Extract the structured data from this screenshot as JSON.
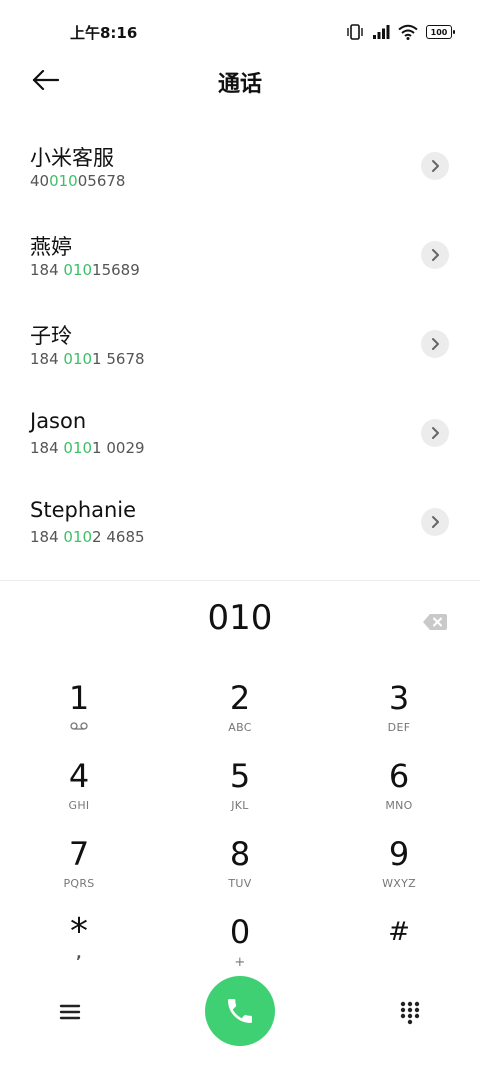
{
  "status_bar": {
    "time": "上午8:16",
    "battery": "100"
  },
  "header": {
    "title": "通话"
  },
  "contacts": [
    {
      "name": "小米客服",
      "number_pre": "40",
      "number_match": "010",
      "number_post": "05678"
    },
    {
      "name": "燕婷",
      "number_pre": "184 ",
      "number_match": "010",
      "number_post": "15689"
    },
    {
      "name": "子玲",
      "number_pre": "184 ",
      "number_match": "010",
      "number_post": "1 5678"
    },
    {
      "name": "Jason",
      "number_pre": "184 ",
      "number_match": "010",
      "number_post": "1 0029"
    },
    {
      "name": "Stephanie",
      "number_pre": "184 ",
      "number_match": "010",
      "number_post": "2 4685"
    }
  ],
  "dialer": {
    "entered": "010"
  },
  "keypad": [
    {
      "digit": "1",
      "letters": ""
    },
    {
      "digit": "2",
      "letters": "ABC"
    },
    {
      "digit": "3",
      "letters": "DEF"
    },
    {
      "digit": "4",
      "letters": "GHI"
    },
    {
      "digit": "5",
      "letters": "JKL"
    },
    {
      "digit": "6",
      "letters": "MNO"
    },
    {
      "digit": "7",
      "letters": "PQRS"
    },
    {
      "digit": "8",
      "letters": "TUV"
    },
    {
      "digit": "9",
      "letters": "WXYZ"
    },
    {
      "digit": "*",
      "letters": ","
    },
    {
      "digit": "0",
      "letters": "+"
    },
    {
      "digit": "#",
      "letters": ""
    }
  ],
  "icons": {
    "back": "back-arrow-icon",
    "backspace": "backspace-icon",
    "menu": "menu-icon",
    "call": "phone-icon",
    "dialpad": "dialpad-icon",
    "voicemail": "voicemail-icon"
  },
  "colors": {
    "accent_green": "#3cc168",
    "call_button": "#3fd073"
  }
}
